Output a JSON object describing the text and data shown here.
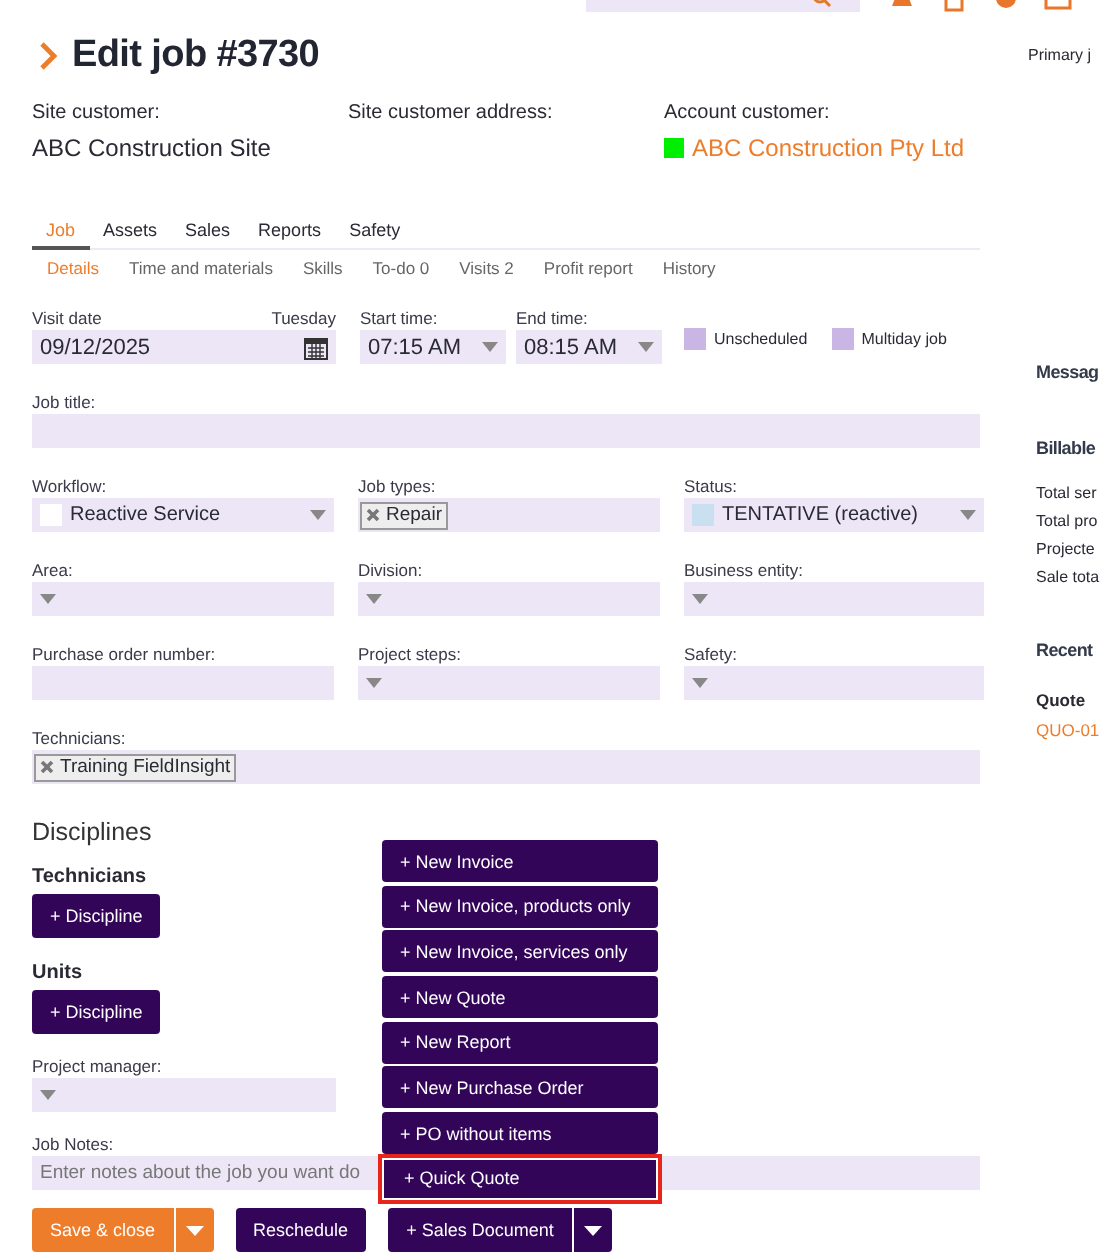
{
  "page": {
    "title": "Edit job #3730",
    "primary": "Primary j"
  },
  "header": [
    {
      "label": "Site customer:",
      "value": "ABC Construction Site",
      "link": false
    },
    {
      "label": "Site customer address:"
    },
    {
      "label": "Account customer:",
      "value": "ABC Construction Pty Ltd",
      "link": true,
      "color": "#00ee00"
    }
  ],
  "tabs": [
    {
      "label": "Job",
      "selected": true
    },
    {
      "label": "Assets",
      "selected": false
    },
    {
      "label": "Sales",
      "selected": false
    },
    {
      "label": "Reports",
      "selected": false
    },
    {
      "label": "Safety",
      "selected": false
    }
  ],
  "subtabs": [
    {
      "label": "Details",
      "selected": true
    },
    {
      "label": "Time and materials",
      "selected": false
    },
    {
      "label": "Skills",
      "selected": false
    },
    {
      "label": "To-do 0",
      "selected": false
    },
    {
      "label": "Visits 2",
      "selected": false
    },
    {
      "label": "Profit report",
      "selected": false
    },
    {
      "label": "History",
      "selected": false
    }
  ],
  "visit": {
    "date_label": "Visit date",
    "day": "Tuesday",
    "date": "09/12/2025",
    "start_label": "Start time:",
    "start": "07:15 AM",
    "end_label": "End time:",
    "end": "08:15 AM",
    "options": [
      {
        "label": "Unscheduled",
        "checked": false
      },
      {
        "label": "Multiday job",
        "checked": false
      }
    ]
  },
  "form_rows": [
    [
      {
        "label": "Job title:",
        "kind": "text"
      }
    ],
    [
      {
        "label": "Workflow:",
        "kind": "select",
        "value": "Reactive Service",
        "color": "#ffffff"
      },
      {
        "label": "Job types:",
        "kind": "tags",
        "tags": [
          "Repair"
        ]
      },
      {
        "label": "Status:",
        "kind": "select",
        "value": "TENTATIVE (reactive)",
        "color": "#c9e0f0"
      }
    ],
    [
      {
        "label": "Area:",
        "kind": "select"
      },
      {
        "label": "Division:",
        "kind": "select"
      },
      {
        "label": "Business entity:",
        "kind": "select"
      }
    ],
    [
      {
        "label": "Purchase order number:",
        "kind": "text"
      },
      {
        "label": "Project steps:",
        "kind": "select"
      },
      {
        "label": "Safety:",
        "kind": "select"
      }
    ],
    [
      {
        "label": "Technicians:",
        "kind": "tags",
        "tags": [
          "Training FieldInsight"
        ]
      }
    ]
  ],
  "disciplines": {
    "title": "Disciplines",
    "groups": [
      {
        "label": "Technicians",
        "button": "+ Discipline"
      },
      {
        "label": "Units",
        "button": "+ Discipline"
      }
    ]
  },
  "project_manager": {
    "label": "Project manager:",
    "kind": "select"
  },
  "notes": {
    "label": "Job Notes:",
    "placeholder": "Enter notes about the job you want do"
  },
  "actions": [
    {
      "label": "Save & close",
      "kind": "orange-split"
    },
    {
      "label": "Reschedule",
      "kind": "plain"
    },
    {
      "label": "+ Sales Document",
      "kind": "purple-split"
    }
  ],
  "sales_menu": [
    {
      "label": "+ New Invoice",
      "highlighted": false
    },
    {
      "label": "+ New Invoice, products only",
      "highlighted": false
    },
    {
      "label": "+ New Invoice, services only",
      "highlighted": false
    },
    {
      "label": "+ New Quote",
      "highlighted": false
    },
    {
      "label": "+ New Report",
      "highlighted": false
    },
    {
      "label": "+ New Purchase Order",
      "highlighted": false
    },
    {
      "label": "+ PO without items",
      "highlighted": false
    },
    {
      "label": "+ Quick Quote",
      "highlighted": true
    }
  ],
  "side_panel": {
    "messages": "Messag",
    "billable": "Billable",
    "totals": [
      "Total ser",
      "Total pro",
      "Projecte",
      "Sale tota"
    ],
    "recent": "Recent",
    "quote_label": "Quote",
    "quote_link": "QUO-01"
  }
}
